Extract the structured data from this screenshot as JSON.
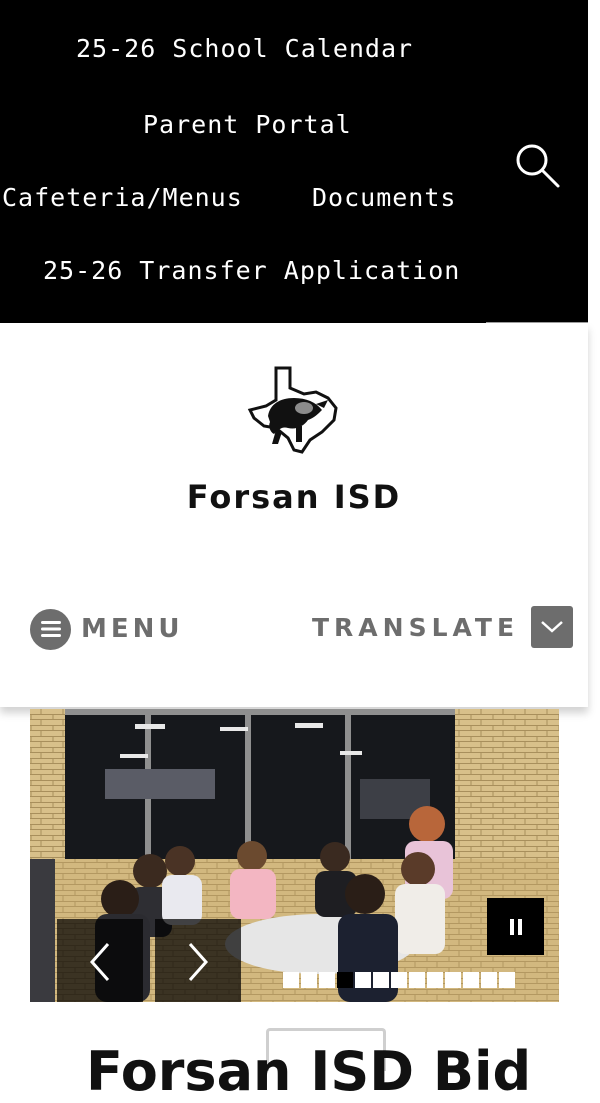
{
  "top_nav": {
    "links": [
      {
        "label": "25-26 School Calendar"
      },
      {
        "label": "Parent Portal"
      },
      {
        "label": "Cafeteria/Menus"
      },
      {
        "label": "Documents"
      },
      {
        "label": "25-26 Transfer Application"
      }
    ],
    "search_icon": "search-icon",
    "background": "#000000",
    "text_color": "#ffffff"
  },
  "header": {
    "logo_icon": "texas-bison-logo",
    "site_title": "Forsan ISD",
    "menu_label": "MENU",
    "translate_label": "TRANSLATE",
    "control_color": "#6d6d6d"
  },
  "slideshow": {
    "total_slides": 13,
    "active_slide": 4,
    "prev_icon": "chevron-left-icon",
    "next_icon": "chevron-right-icon",
    "pause_icon": "pause-icon"
  },
  "below_fold": {
    "heading_partial": "Forsan ISD Bid"
  }
}
